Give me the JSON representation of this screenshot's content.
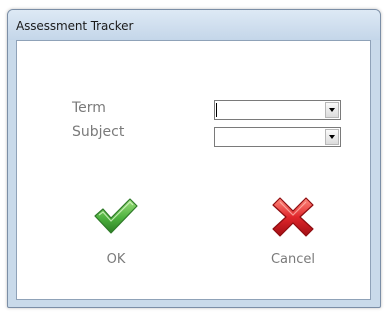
{
  "window": {
    "title": "Assessment Tracker"
  },
  "form": {
    "term": {
      "label": "Term",
      "value": ""
    },
    "subject": {
      "label": "Subject",
      "value": ""
    }
  },
  "actions": {
    "ok": {
      "label": "OK",
      "icon": "checkmark-icon",
      "color": "#3a9a34"
    },
    "cancel": {
      "label": "Cancel",
      "icon": "close-icon",
      "color": "#c0161b"
    }
  }
}
